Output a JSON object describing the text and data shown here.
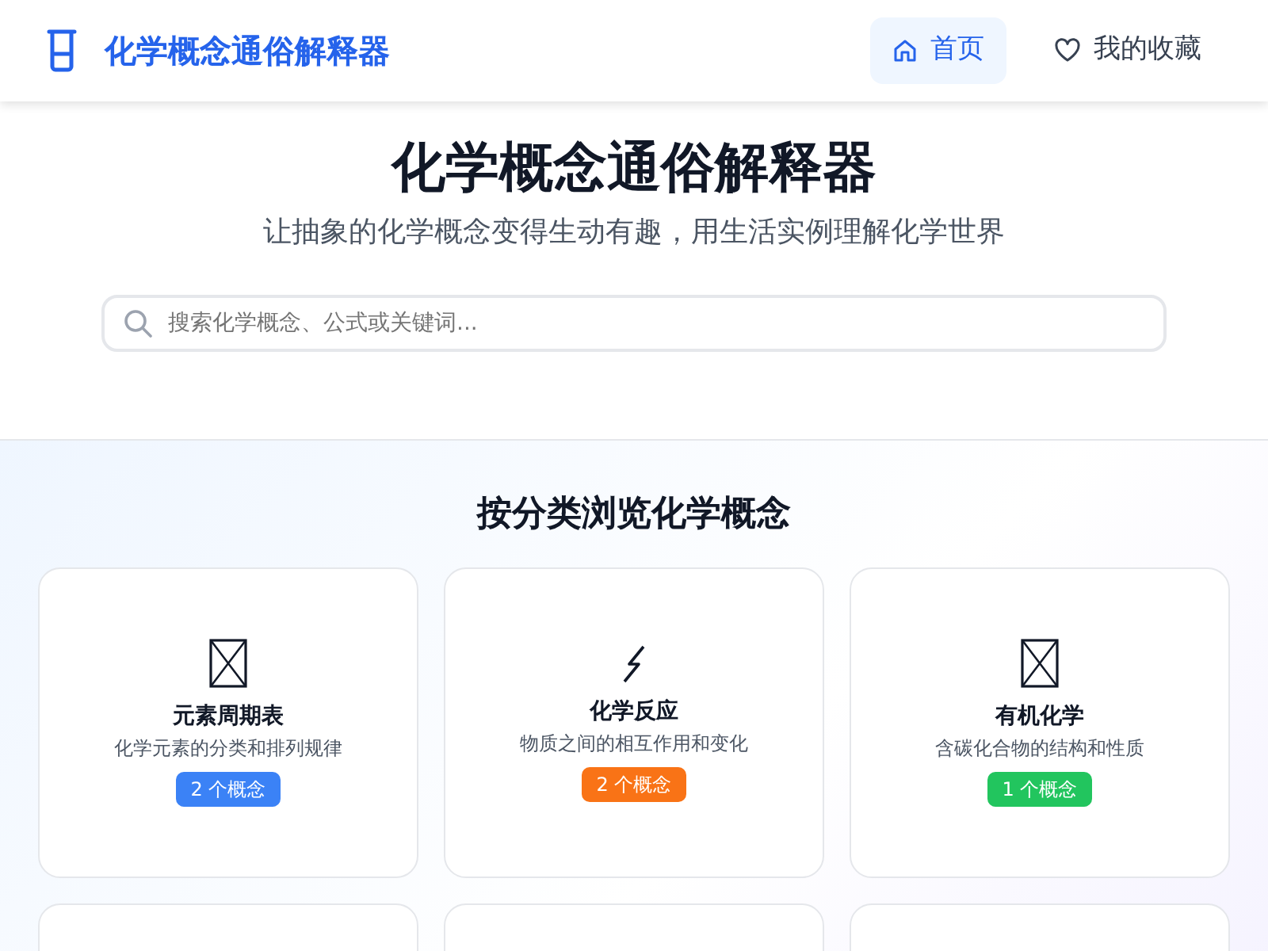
{
  "navbar": {
    "brand": "化学概念通俗解释器",
    "links": [
      {
        "label": "首页",
        "selected": true
      },
      {
        "label": "我的收藏",
        "selected": false
      }
    ]
  },
  "hero": {
    "title": "化学概念通俗解释器",
    "subtitle": "让抽象的化学概念变得生动有趣，用生活实例理解化学世界",
    "search": {
      "placeholder": "搜索化学概念、公式或关键词..."
    }
  },
  "section_title": "按分类浏览化学概念",
  "categories": [
    {
      "title": "元素周期表",
      "description": "化学元素的分类和排列规律",
      "count": "2 个概念",
      "color": "#3b82f6"
    },
    {
      "title": "化学反应",
      "description": "物质之间的相互作用和变化",
      "count": "2 个概念",
      "color": "#f97316"
    },
    {
      "title": "有机化学",
      "description": "含碳化合物的结构和性质",
      "count": "1 个概念",
      "color": "#22c55e"
    }
  ]
}
